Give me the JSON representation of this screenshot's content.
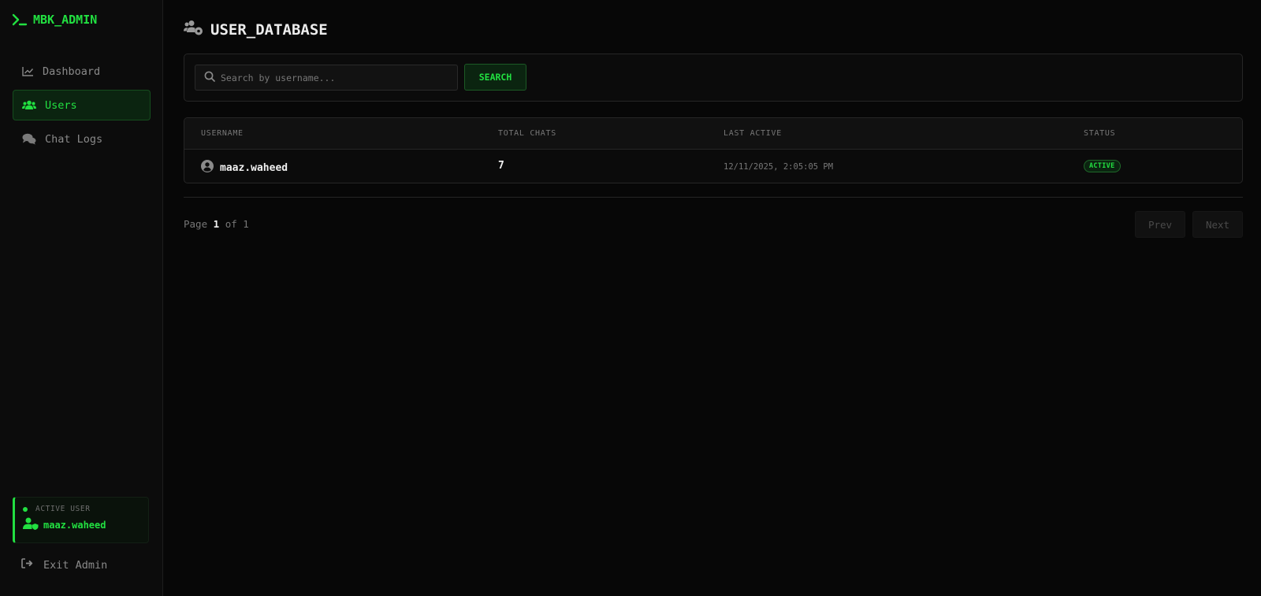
{
  "brand": {
    "name": "MBK_ADMIN"
  },
  "nav": [
    {
      "label": "Dashboard",
      "icon": "chart-line-icon",
      "active": false
    },
    {
      "label": "Users",
      "icon": "users-icon",
      "active": true
    },
    {
      "label": "Chat Logs",
      "icon": "comments-icon",
      "active": false
    }
  ],
  "active_user": {
    "label": "ACTIVE USER",
    "name": "maaz.waheed"
  },
  "exit": {
    "label": "Exit Admin"
  },
  "page": {
    "title": "USER_DATABASE"
  },
  "search": {
    "placeholder": "Search by username...",
    "value": "",
    "button": "SEARCH"
  },
  "table": {
    "headers": [
      "USERNAME",
      "TOTAL CHATS",
      "LAST ACTIVE",
      "STATUS"
    ],
    "rows": [
      {
        "username": "maaz.waheed",
        "total_chats": "7",
        "last_active": "12/11/2025, 2:05:05 PM",
        "status": "ACTIVE"
      }
    ]
  },
  "pagination": {
    "page_label": "Page",
    "current": "1",
    "of_label": "of",
    "total": "1",
    "prev": "Prev",
    "next": "Next"
  },
  "colors": {
    "accent": "#22e041",
    "background": "#070707",
    "sidebar": "#0c0c0c",
    "border": "#262626"
  }
}
